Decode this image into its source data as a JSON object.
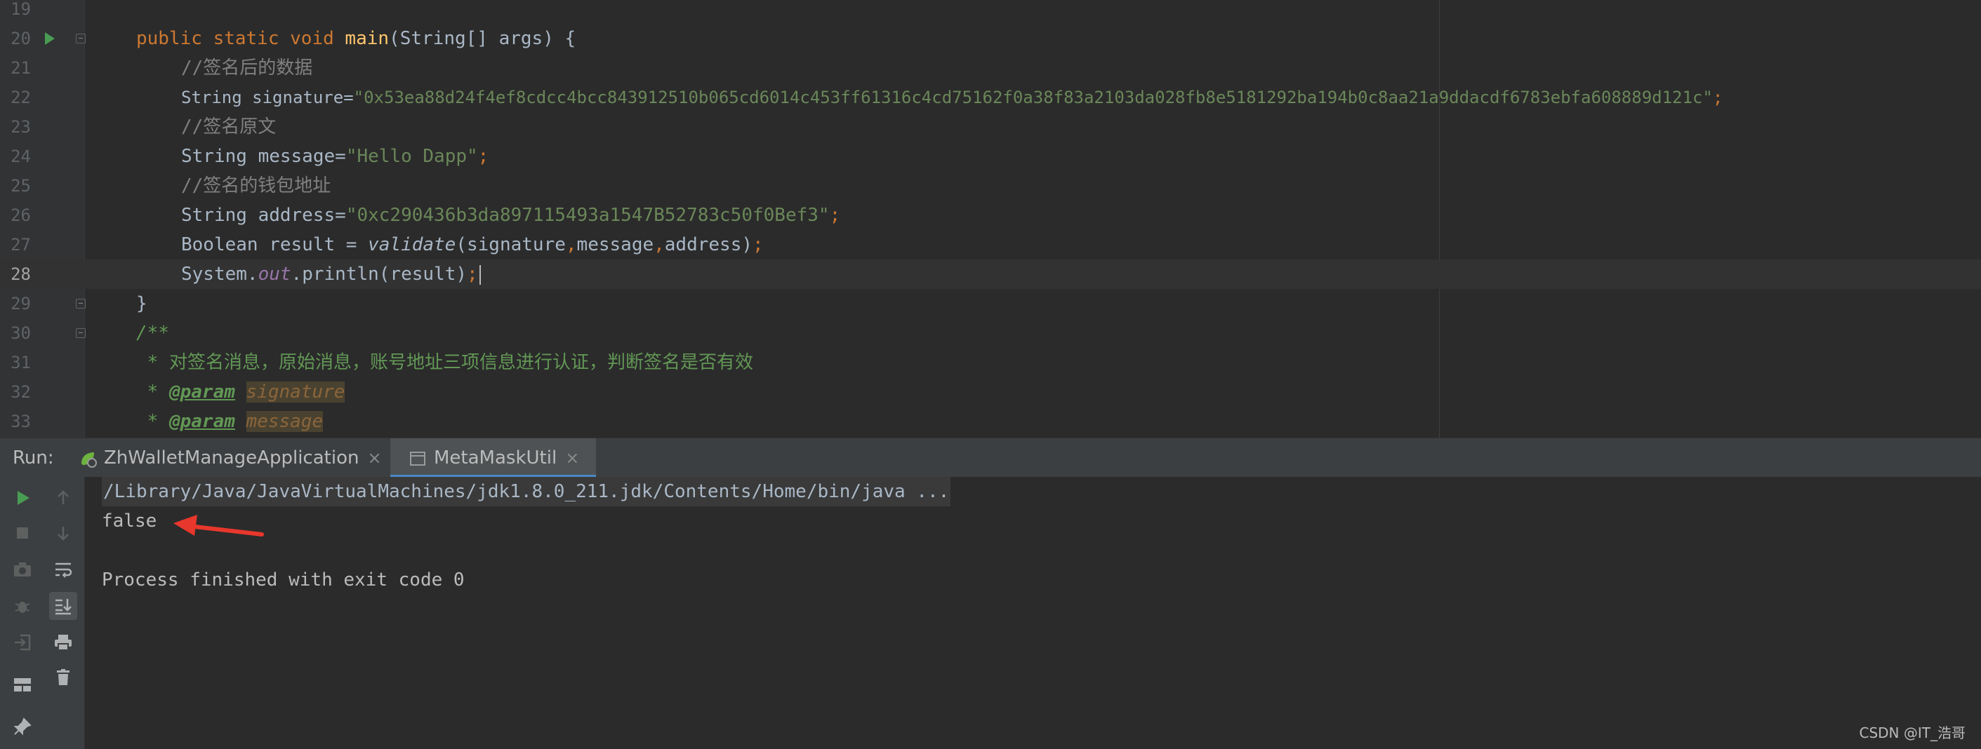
{
  "editor": {
    "lines": [
      {
        "num": "19"
      },
      {
        "num": "20"
      },
      {
        "num": "21"
      },
      {
        "num": "22"
      },
      {
        "num": "23"
      },
      {
        "num": "24"
      },
      {
        "num": "25"
      },
      {
        "num": "26"
      },
      {
        "num": "27"
      },
      {
        "num": "28"
      },
      {
        "num": "29"
      },
      {
        "num": "30"
      },
      {
        "num": "31"
      },
      {
        "num": "32"
      },
      {
        "num": "33"
      }
    ],
    "code": {
      "l20_kw": "public static void ",
      "l20_fn": "main",
      "l20_rest": "(String[] args) {",
      "l21": "//签名后的数据",
      "l22_a": "String signature=",
      "l22_str": "\"0x53ea88d24f4ef8cdcc4bcc843912510b065cd6014c453ff61316c4cd75162f0a38f83a2103da028fb8e5181292ba194b0c8aa21a9ddacdf6783ebfa608889d121c\"",
      "l22_semi": ";",
      "l23": "//签名原文",
      "l24_a": "String message=",
      "l24_str": "\"Hello Dapp\"",
      "l24_semi": ";",
      "l25": "//签名的钱包地址",
      "l26_a": "String address=",
      "l26_str": "\"0xc290436b3da897115493a1547B52783c50f0Bef3\"",
      "l26_semi": ";",
      "l27_a": "Boolean result = ",
      "l27_fn": "validate",
      "l27_b": "(signature",
      "l27_c1": ",",
      "l27_c": "message",
      "l27_c2": ",",
      "l27_d": "address)",
      "l27_semi": ";",
      "l28_a": "System.",
      "l28_out": "out",
      "l28_b": ".println(result)",
      "l28_semi": ";",
      "l29": "}",
      "l30": "/**",
      "l31": " * 对签名消息，原始消息，账号地址三项信息进行认证，判断签名是否有效",
      "l32_star": " * ",
      "l32_tag": "@param",
      "l32_p": "signature",
      "l33_star": " * ",
      "l33_tag": "@param",
      "l33_p": "message"
    }
  },
  "run": {
    "label": "Run:",
    "tabs": [
      {
        "label": "ZhWalletManageApplication",
        "close": "×"
      },
      {
        "label": "MetaMaskUtil",
        "close": "×"
      }
    ]
  },
  "console": {
    "lines": [
      "/Library/Java/JavaVirtualMachines/jdk1.8.0_211.jdk/Contents/Home/bin/java ...",
      "false",
      "",
      "Process finished with exit code 0"
    ]
  },
  "watermark": "CSDN @IT_浩哥",
  "colors": {
    "keyword": "#cc7832",
    "string": "#6a8759",
    "comment": "#808080",
    "doc": "#629755",
    "arrow": "#e8372c",
    "run_green": "#499c54",
    "tab_underline": "#4a88c7"
  }
}
